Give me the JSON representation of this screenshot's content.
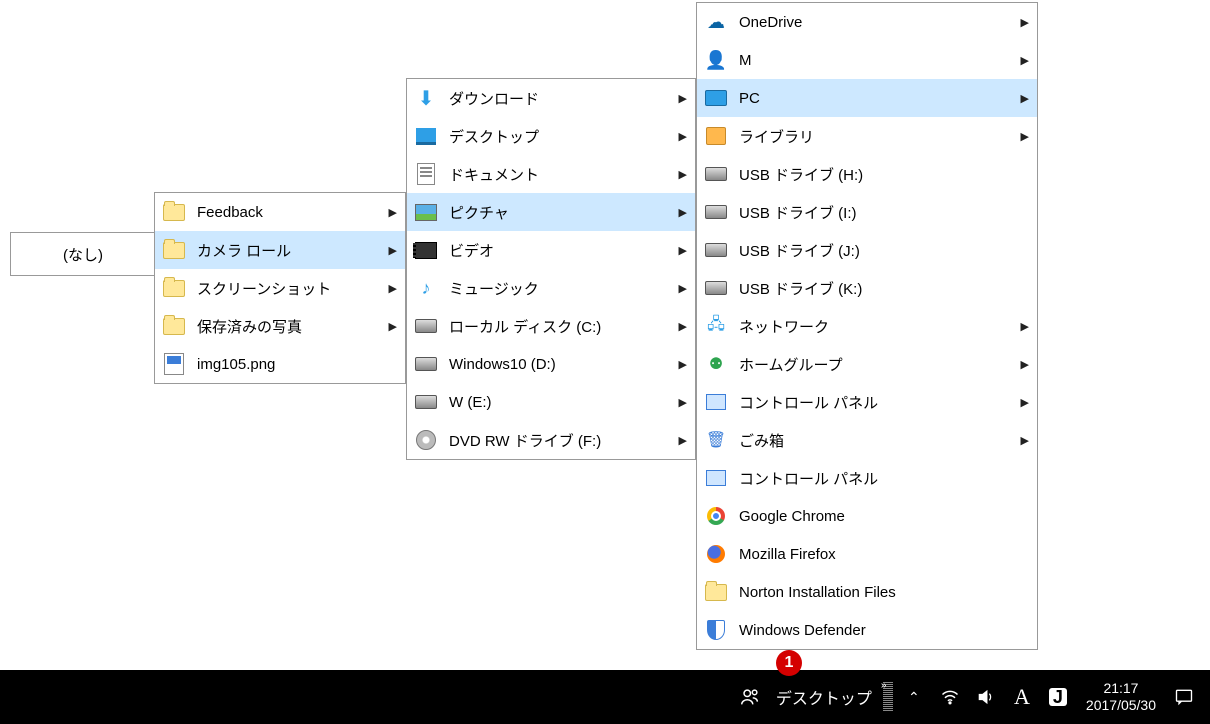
{
  "root": {
    "label": "(なし)"
  },
  "menu1": {
    "items": [
      {
        "label": "Feedback",
        "icon": "folder",
        "submenu": true,
        "hl": false
      },
      {
        "label": "カメラ ロール",
        "icon": "folder",
        "submenu": true,
        "hl": true
      },
      {
        "label": "スクリーンショット",
        "icon": "folder",
        "submenu": true,
        "hl": false
      },
      {
        "label": "保存済みの写真",
        "icon": "folder",
        "submenu": true,
        "hl": false
      },
      {
        "label": "img105.png",
        "icon": "imgfile",
        "submenu": false,
        "hl": false
      }
    ]
  },
  "menu2": {
    "items": [
      {
        "label": "ダウンロード",
        "icon": "dl-arrow",
        "submenu": true,
        "hl": false
      },
      {
        "label": "デスクトップ",
        "icon": "desktop-ico",
        "submenu": true,
        "hl": false
      },
      {
        "label": "ドキュメント",
        "icon": "doc",
        "submenu": true,
        "hl": false
      },
      {
        "label": "ピクチャ",
        "icon": "pic",
        "submenu": true,
        "hl": true
      },
      {
        "label": "ビデオ",
        "icon": "vid",
        "submenu": true,
        "hl": false
      },
      {
        "label": "ミュージック",
        "icon": "music",
        "submenu": true,
        "hl": false
      },
      {
        "label": "ローカル ディスク (C:)",
        "icon": "disk",
        "submenu": true,
        "hl": false
      },
      {
        "label": "Windows10 (D:)",
        "icon": "disk",
        "submenu": true,
        "hl": false
      },
      {
        "label": "W (E:)",
        "icon": "disk",
        "submenu": true,
        "hl": false
      },
      {
        "label": "DVD RW ドライブ (F:)",
        "icon": "dvd",
        "submenu": true,
        "hl": false
      }
    ]
  },
  "menu3": {
    "items": [
      {
        "label": "OneDrive",
        "icon": "cloud",
        "submenu": true,
        "hl": false
      },
      {
        "label": "M",
        "icon": "person",
        "submenu": true,
        "hl": false
      },
      {
        "label": "PC",
        "icon": "monitor",
        "submenu": true,
        "hl": true
      },
      {
        "label": "ライブラリ",
        "icon": "lib",
        "submenu": true,
        "hl": false
      },
      {
        "label": "USB ドライブ (H:)",
        "icon": "disk",
        "submenu": false,
        "hl": false
      },
      {
        "label": "USB ドライブ (I:)",
        "icon": "disk",
        "submenu": false,
        "hl": false
      },
      {
        "label": "USB ドライブ (J:)",
        "icon": "disk",
        "submenu": false,
        "hl": false
      },
      {
        "label": "USB ドライブ (K:)",
        "icon": "disk",
        "submenu": false,
        "hl": false
      },
      {
        "label": "ネットワーク",
        "icon": "net",
        "submenu": true,
        "hl": false
      },
      {
        "label": "ホームグループ",
        "icon": "home",
        "submenu": true,
        "hl": false
      },
      {
        "label": "コントロール パネル",
        "icon": "ctrl",
        "submenu": true,
        "hl": false
      },
      {
        "label": "ごみ箱",
        "icon": "trash",
        "submenu": true,
        "hl": false
      },
      {
        "label": "コントロール パネル",
        "icon": "ctrl",
        "submenu": false,
        "hl": false
      },
      {
        "label": "Google Chrome",
        "icon": "chrome",
        "submenu": false,
        "hl": false
      },
      {
        "label": "Mozilla Firefox",
        "icon": "firefox",
        "submenu": false,
        "hl": false
      },
      {
        "label": "Norton Installation Files",
        "icon": "folder",
        "submenu": false,
        "hl": false
      },
      {
        "label": "Windows Defender",
        "icon": "shield",
        "submenu": false,
        "hl": false
      }
    ]
  },
  "taskbar": {
    "annotation_badge": "1",
    "desktop_toolbar_label": "デスクトップ",
    "ime_letter": "A",
    "time": "21:17",
    "date": "2017/05/30"
  }
}
